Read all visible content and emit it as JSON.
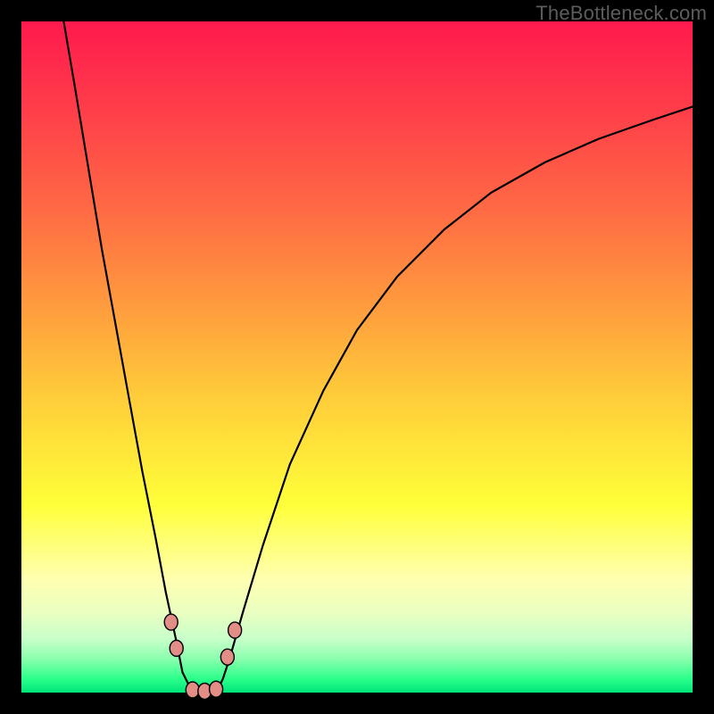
{
  "watermark": "TheBottleneck.com",
  "colors": {
    "frame_border": "#000000",
    "gradient_top": "#ff1a4d",
    "gradient_bottom": "#00e57a",
    "curve": "#000000",
    "bead_fill": "#e38d87"
  },
  "chart_data": {
    "type": "line",
    "title": "",
    "xlabel": "",
    "ylabel": "",
    "xlim": [
      0,
      100
    ],
    "ylim": [
      0,
      100
    ],
    "grid": false,
    "legend": false,
    "note": "No numeric axis labels are rendered in the image; x and y values below are estimated from pixel positions on a 0–100 normalized scale.",
    "series": [
      {
        "name": "bottleneck-curve",
        "x": [
          6.3,
          8,
          10,
          12,
          14,
          16,
          18,
          20,
          21.5,
          23,
          24,
          25.5,
          27,
          29,
          30,
          31,
          33,
          36,
          40,
          45,
          50,
          56,
          63,
          70,
          78,
          86,
          94,
          100
        ],
        "y": [
          100,
          90,
          78,
          66,
          55,
          44,
          33,
          23,
          15,
          8,
          3,
          0,
          0,
          0,
          2,
          5,
          12,
          22,
          34,
          45,
          54,
          62,
          69,
          74.5,
          79,
          82.5,
          85.3,
          87.3
        ]
      }
    ],
    "markers": [
      {
        "name": "left-bead-upper",
        "x": 22.3,
        "y": 10.5
      },
      {
        "name": "left-bead-lower",
        "x": 23.1,
        "y": 6.6
      },
      {
        "name": "floor-bead-1",
        "x": 25.5,
        "y": 0.4
      },
      {
        "name": "floor-bead-2",
        "x": 27.3,
        "y": 0.2
      },
      {
        "name": "floor-bead-3",
        "x": 29.0,
        "y": 0.5
      },
      {
        "name": "right-bead-lower",
        "x": 30.7,
        "y": 5.3
      },
      {
        "name": "right-bead-upper",
        "x": 31.8,
        "y": 9.3
      }
    ]
  }
}
